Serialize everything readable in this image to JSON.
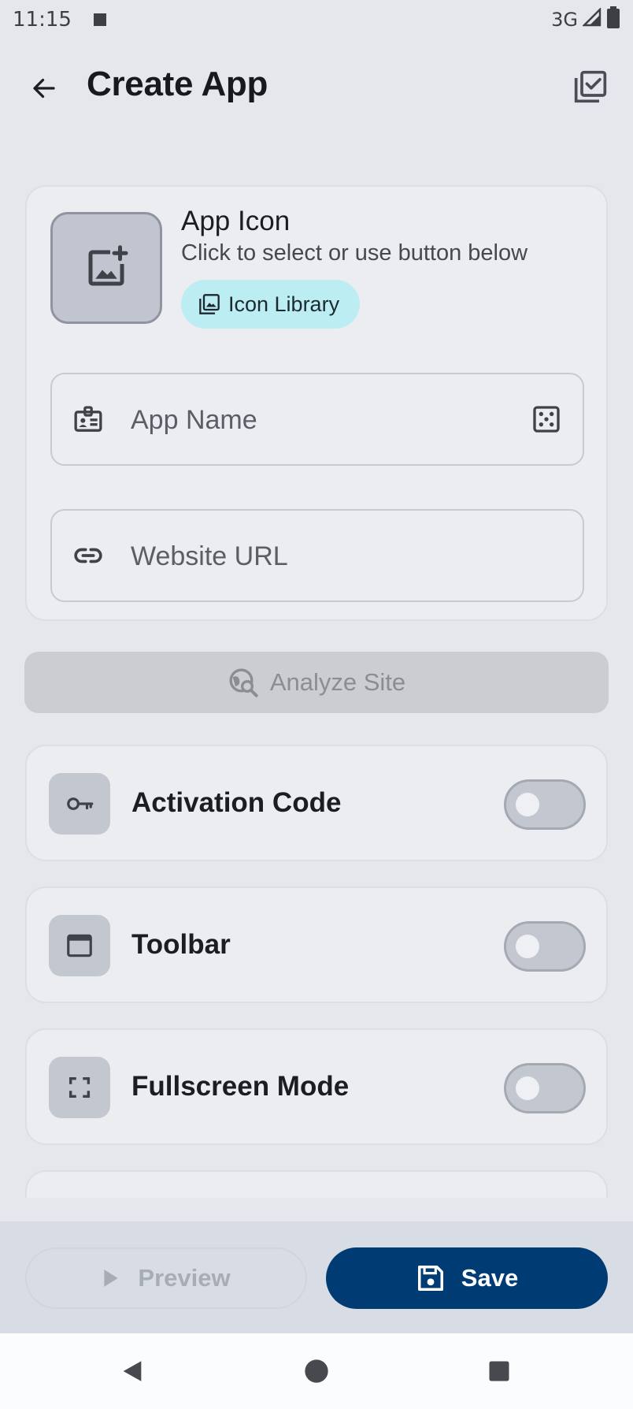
{
  "status_bar": {
    "time": "11:15",
    "network": "3G"
  },
  "app_bar": {
    "title": "Create App",
    "back_icon": "arrow-left-icon",
    "action_icon": "select-all-icon"
  },
  "app_icon_section": {
    "title": "App Icon",
    "subtitle": "Click to select or use button below",
    "library_button": "Icon Library"
  },
  "fields": {
    "app_name": {
      "value": "",
      "placeholder": "App Name"
    },
    "website_url": {
      "value": "",
      "placeholder": "Website URL"
    }
  },
  "analyze_button": "Analyze Site",
  "toggles": [
    {
      "label": "Activation Code",
      "icon": "key-icon",
      "on": false
    },
    {
      "label": "Toolbar",
      "icon": "window-icon",
      "on": false
    },
    {
      "label": "Fullscreen Mode",
      "icon": "fullscreen-icon",
      "on": false
    }
  ],
  "bottom_bar": {
    "preview_label": "Preview",
    "save_label": "Save"
  },
  "colors": {
    "background": "#e5e7ec",
    "card": "#ecedf1",
    "primary": "#003b73",
    "chip": "#bbedf2",
    "disabled": "#cccdd2"
  }
}
